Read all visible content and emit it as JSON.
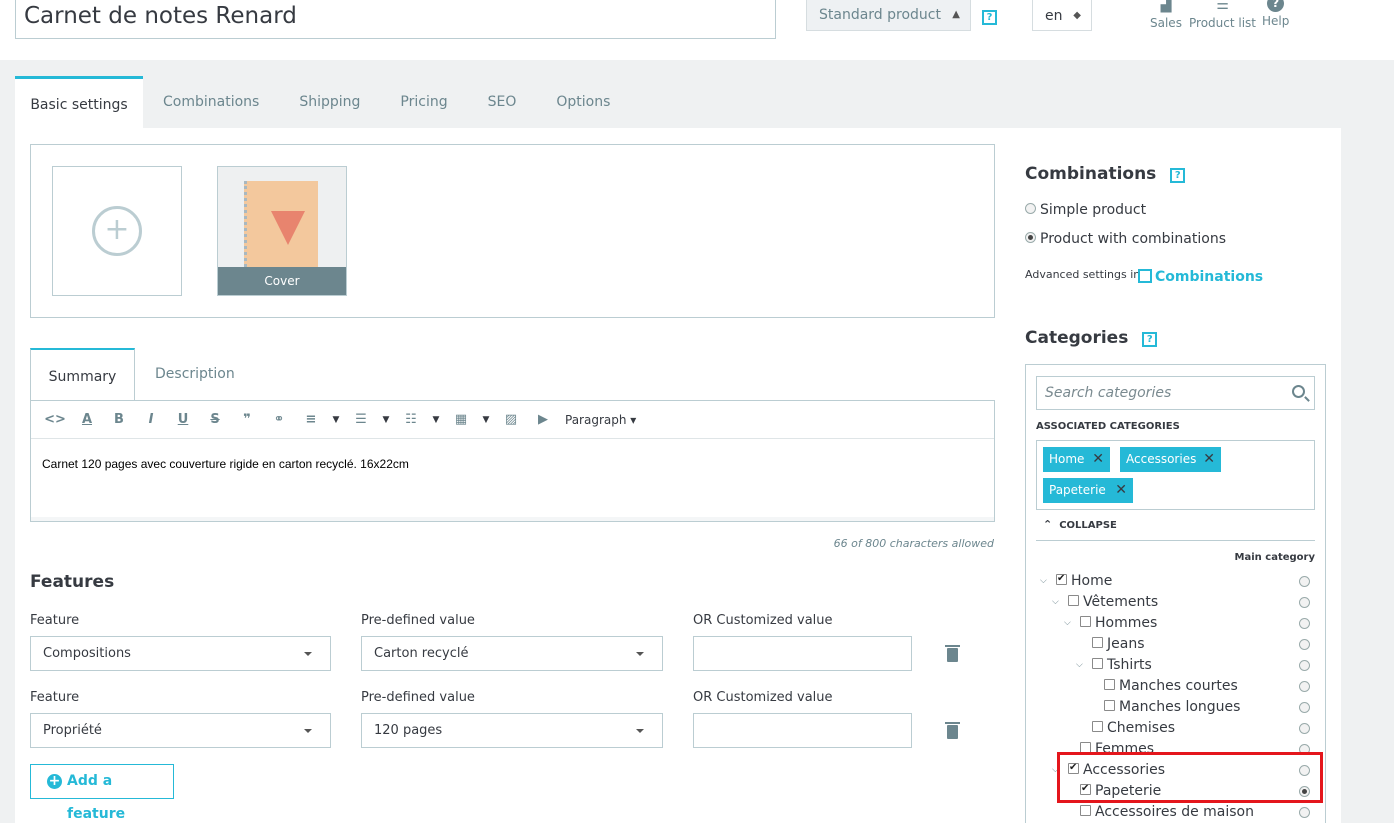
{
  "header": {
    "product_name": "Carnet de notes Renard",
    "product_type": "Standard product",
    "language": "en",
    "help_badge": "?",
    "links": [
      {
        "label": "Sales",
        "icon": "bar-chart-icon"
      },
      {
        "label": "Product list",
        "icon": "list-icon"
      },
      {
        "label": "Help",
        "icon": "help-icon"
      }
    ]
  },
  "tabs": [
    "Basic settings",
    "Combinations",
    "Shipping",
    "Pricing",
    "SEO",
    "Options"
  ],
  "images": {
    "cover_label": "Cover"
  },
  "summary": {
    "tabs": [
      "Summary",
      "Description"
    ],
    "paragraph_label": "Paragraph",
    "text": "Carnet 120 pages avec couverture rigide en carton recyclé. 16x22cm",
    "char_count": "66 of 800 characters allowed"
  },
  "features": {
    "title": "Features",
    "feature_label": "Feature",
    "predefined_label": "Pre-defined value",
    "custom_label": "OR Customized value",
    "rows": [
      {
        "feature": "Compositions",
        "value": "Carton recyclé",
        "custom": ""
      },
      {
        "feature": "Propriété",
        "value": "120 pages",
        "custom": ""
      }
    ],
    "add_label": "Add a feature"
  },
  "combinations": {
    "title": "Combinations",
    "options": [
      "Simple product",
      "Product with combinations"
    ],
    "selected": "Product with combinations",
    "advanced_text": "Advanced settings in",
    "advanced_link": "Combinations"
  },
  "categories": {
    "title": "Categories",
    "search_placeholder": "Search categories",
    "associated_label": "ASSOCIATED CATEGORIES",
    "associated": [
      "Home",
      "Accessories",
      "Papeterie"
    ],
    "collapse_label": "COLLAPSE",
    "main_category_label": "Main category",
    "tree": [
      {
        "label": "Home",
        "checked": true
      },
      {
        "label": "Vêtements",
        "checked": false
      },
      {
        "label": "Hommes",
        "checked": false
      },
      {
        "label": "Jeans",
        "checked": false
      },
      {
        "label": "Tshirts",
        "checked": false
      },
      {
        "label": "Manches courtes",
        "checked": false
      },
      {
        "label": "Manches longues",
        "checked": false
      },
      {
        "label": "Chemises",
        "checked": false
      },
      {
        "label": "Femmes",
        "checked": false
      },
      {
        "label": "Accessories",
        "checked": true
      },
      {
        "label": "Papeterie",
        "checked": true,
        "main": true
      },
      {
        "label": "Accessoires de maison",
        "checked": false
      }
    ]
  },
  "colors": {
    "accent": "#25b9d7",
    "highlight": "#e4161c"
  }
}
